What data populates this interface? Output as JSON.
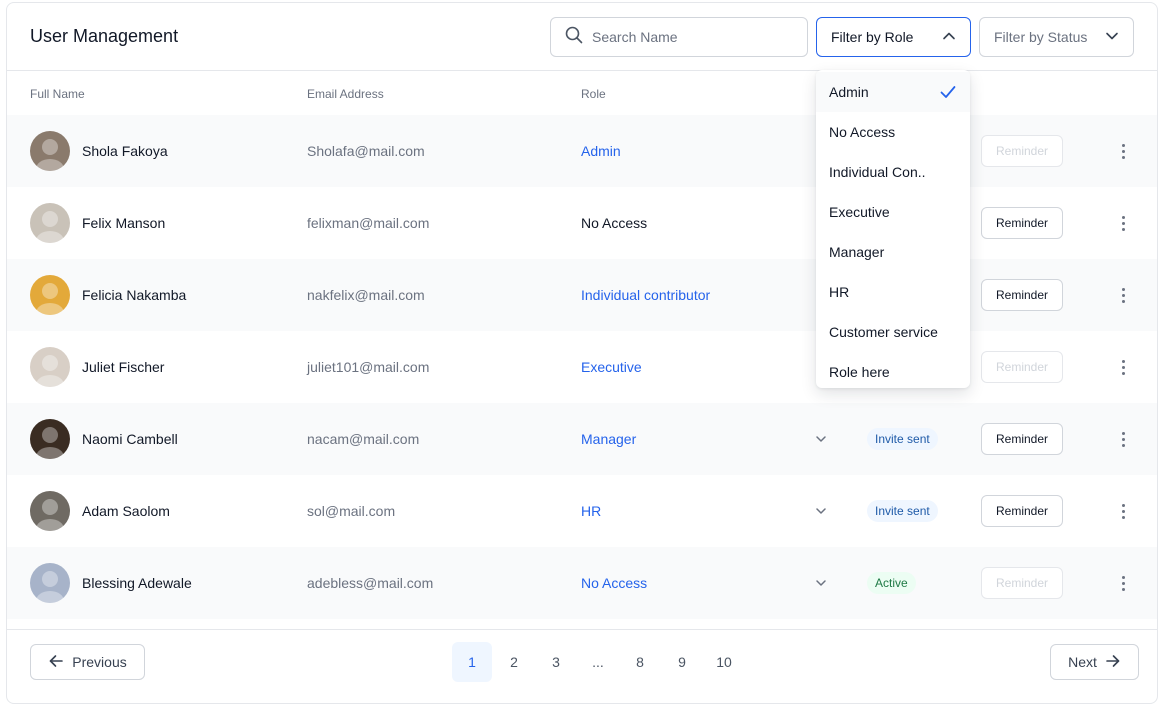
{
  "title": "User Management",
  "search": {
    "placeholder": "Search Name"
  },
  "filters": {
    "role_label": "Filter by Role",
    "status_label": "Filter by Status"
  },
  "columns": {
    "full_name": "Full Name",
    "email": "Email Address",
    "role": "Role"
  },
  "users": [
    {
      "name": "Shola Fakoya",
      "email": "Sholafa@mail.com",
      "role": "Admin",
      "role_style": "link",
      "has_caret": false,
      "status": "",
      "reminder": "Reminder",
      "reminder_enabled": false,
      "avatar_color": "#8a7a6c"
    },
    {
      "name": "Felix Manson",
      "email": "felixman@mail.com",
      "role": "No Access",
      "role_style": "plain",
      "has_caret": false,
      "status": "",
      "reminder": "Reminder",
      "reminder_enabled": true,
      "avatar_color": "#c9c2b8"
    },
    {
      "name": "Felicia Nakamba",
      "email": "nakfelix@mail.com",
      "role": "Individual contributor",
      "role_style": "link",
      "has_caret": false,
      "status": "",
      "reminder": "Reminder",
      "reminder_enabled": true,
      "avatar_color": "#e3a93a"
    },
    {
      "name": "Juliet Fischer",
      "email": "juliet101@mail.com",
      "role": "Executive",
      "role_style": "link",
      "has_caret": false,
      "status": "",
      "reminder": "Reminder",
      "reminder_enabled": false,
      "avatar_color": "#d8cfc6"
    },
    {
      "name": "Naomi Cambell",
      "email": "nacam@mail.com",
      "role": "Manager",
      "role_style": "link",
      "has_caret": true,
      "status": "Invite sent",
      "status_kind": "invite",
      "reminder": "Reminder",
      "reminder_enabled": true,
      "avatar_color": "#3a2c22"
    },
    {
      "name": "Adam Saolom",
      "email": "sol@mail.com",
      "role": "HR",
      "role_style": "link",
      "has_caret": true,
      "status": "Invite sent",
      "status_kind": "invite",
      "reminder": "Reminder",
      "reminder_enabled": true,
      "avatar_color": "#6f6a63"
    },
    {
      "name": "Blessing Adewale",
      "email": "adebless@mail.com",
      "role": "No Access",
      "role_style": "link",
      "has_caret": true,
      "status": "Active",
      "status_kind": "active",
      "reminder": "Reminder",
      "reminder_enabled": false,
      "avatar_color": "#a7b3c9"
    }
  ],
  "pagination": {
    "previous": "Previous",
    "next": "Next",
    "pages": [
      "1",
      "2",
      "3",
      "...",
      "8",
      "9",
      "10"
    ],
    "current": "1"
  },
  "role_dropdown": {
    "options": [
      "Admin",
      "No Access",
      "Individual Con..",
      "Executive",
      "Manager",
      "HR",
      "Customer service",
      "Role here"
    ],
    "selected": "Admin"
  },
  "colors": {
    "accent": "#2563eb",
    "border": "#d1d5db",
    "row_alt": "#f9fafb"
  }
}
